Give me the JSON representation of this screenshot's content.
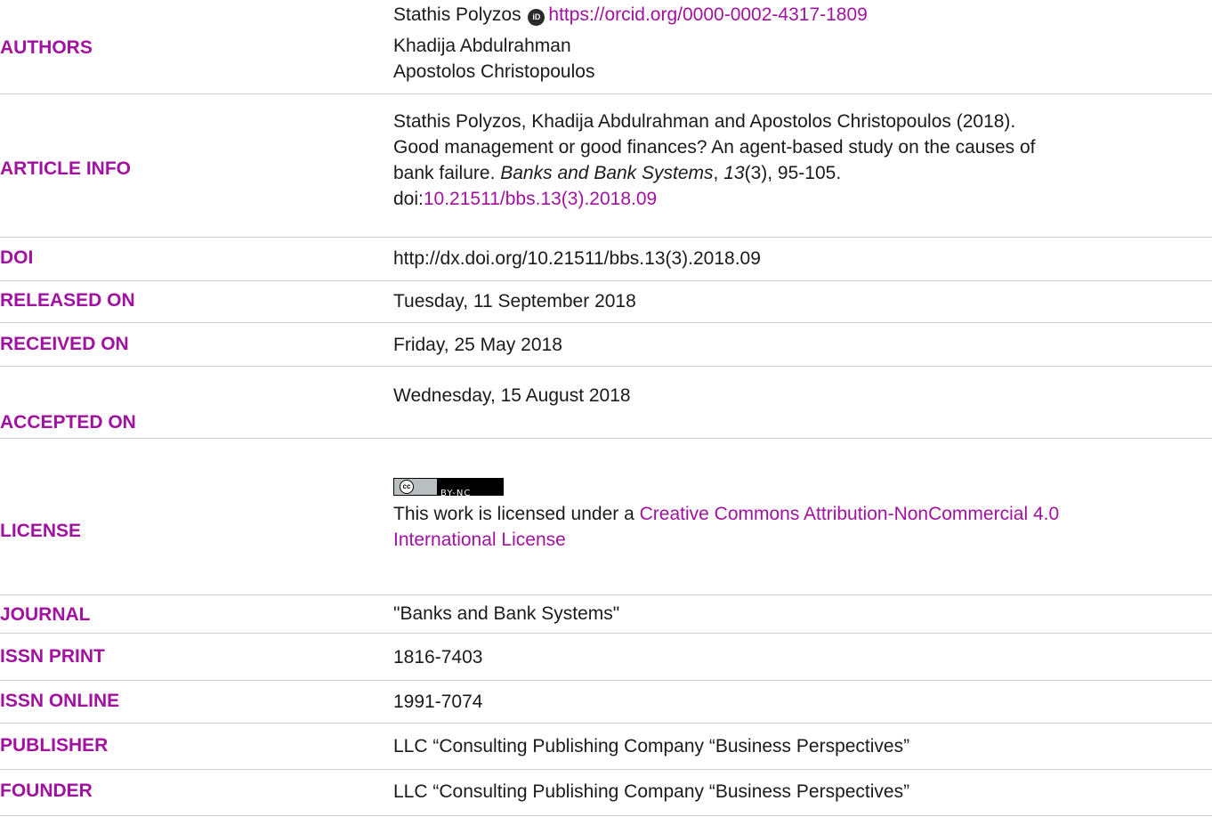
{
  "authors": {
    "label": "AUTHORS",
    "author1": "Stathis Polyzos",
    "orcid_icon": "orcid-icon",
    "orcid_icon_text": "iD",
    "orcid_url": "https://orcid.org/0000-0002-4317-1809",
    "author2": "Khadija Abdulrahman",
    "author3": "Apostolos Christopoulos"
  },
  "article_info": {
    "label": "ARTICLE INFO",
    "line1": "Stathis Polyzos, Khadija Abdulrahman and Apostolos Christopoulos (2018).",
    "line2": "Good management or good finances? An agent-based study on the causes of",
    "line3": "bank failure.",
    "journal": "Banks and Bank Systems",
    "sep1": ",",
    "volume": "13",
    "issue_pages": "(3), 95-105.",
    "doi_prefix": "doi:",
    "doi_link": "10.21511/bbs.13(3).2018.09"
  },
  "doi": {
    "label": "DOI",
    "value": "http://dx.doi.org/10.21511/bbs.13(3).2018.09"
  },
  "released": {
    "label": "RELEASED ON",
    "value": "Tuesday, 11 September 2018"
  },
  "received": {
    "label": "RECEIVED ON",
    "value": "Friday, 25 May 2018"
  },
  "accepted": {
    "label": "ACCEPTED ON",
    "value": "Wednesday, 15 August 2018"
  },
  "license": {
    "label": "LICENSE",
    "badge_cc": "cc",
    "badge_text": "BY-NC",
    "text": "This work is licensed under a ",
    "link_line1": "Creative Commons Attribution-NonCommercial 4.0",
    "link_line2": "International License"
  },
  "journal": {
    "label": "JOURNAL",
    "value": "\"Banks and Bank Systems\""
  },
  "issn_print": {
    "label": "ISSN PRINT",
    "value": "1816-7403"
  },
  "issn_online": {
    "label": "ISSN ONLINE",
    "value": "1991-7074"
  },
  "publisher": {
    "label": "PUBLISHER",
    "value": "LLC “Consulting Publishing Company “Business Perspectives”"
  },
  "founder": {
    "label": "FOUNDER",
    "value": "LLC “Consulting Publishing Company “Business Perspectives”"
  },
  "colors": {
    "accent": "#a0129f",
    "text": "#1a1a1a",
    "rule": "#cfcfcf"
  }
}
